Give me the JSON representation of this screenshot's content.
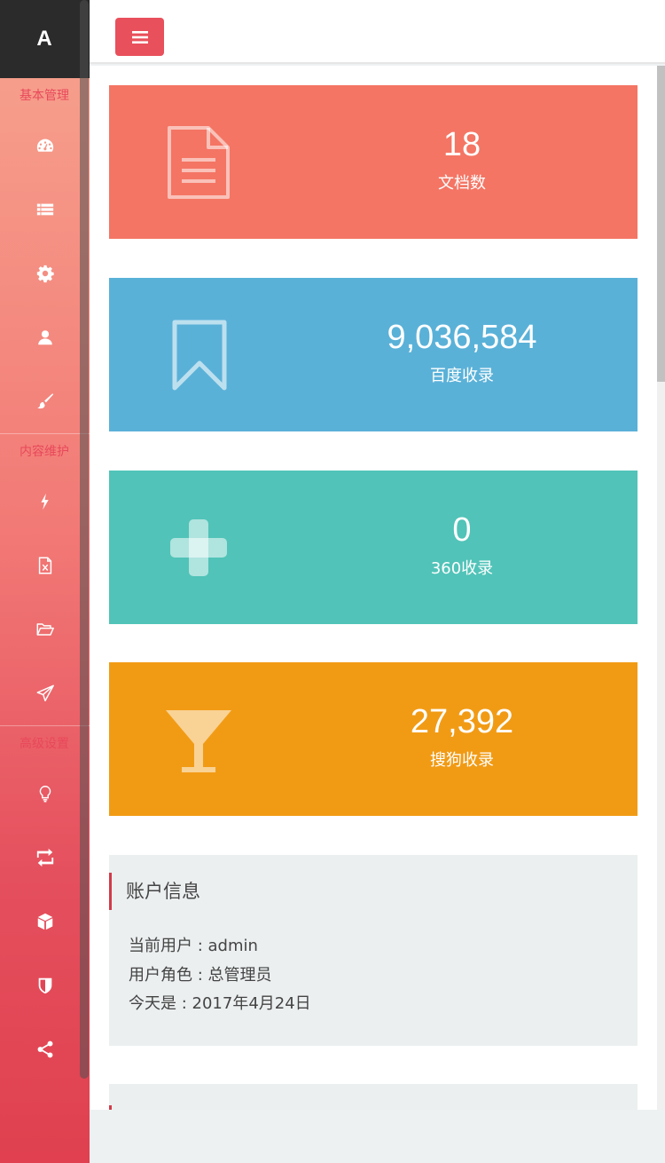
{
  "brand": {
    "logo_letter": "A"
  },
  "sidebar": {
    "sections": [
      {
        "title": "基本管理",
        "items": [
          "dashboard-icon",
          "list-icon",
          "gear-icon",
          "user-icon",
          "brush-icon"
        ]
      },
      {
        "title": "内容维护",
        "items": [
          "bolt-icon",
          "excel-file-icon",
          "folder-open-icon",
          "paper-plane-icon"
        ]
      },
      {
        "title": "高级设置",
        "items": [
          "lightbulb-icon",
          "retweet-icon",
          "cube-icon",
          "shield-icon",
          "share-icon"
        ]
      }
    ]
  },
  "topbar": {
    "menu_button_icon": "hamburger-icon"
  },
  "stats": [
    {
      "value": "18",
      "label": "文档数",
      "icon": "file-text-icon",
      "color": "#f47564"
    },
    {
      "value": "9,036,584",
      "label": "百度收录",
      "icon": "bookmark-icon",
      "color": "#5ab1d8"
    },
    {
      "value": "0",
      "label": "360收录",
      "icon": "plus-icon",
      "color": "#51c3b8"
    },
    {
      "value": "27,392",
      "label": "搜狗收录",
      "icon": "cocktail-glass-icon",
      "color": "#f19b15"
    }
  ],
  "account": {
    "title": "账户信息",
    "current_user": "当前用户 : admin",
    "user_role": "用户角色 : 总管理员",
    "today": "今天是 : 2017年4月24日"
  },
  "colors": {
    "accent": "#e8505b",
    "sidebar_top": "#f7a48f",
    "sidebar_bottom": "#e0404f",
    "brand_bg": "#2b2b2b",
    "panel_bg": "#eceff0"
  }
}
